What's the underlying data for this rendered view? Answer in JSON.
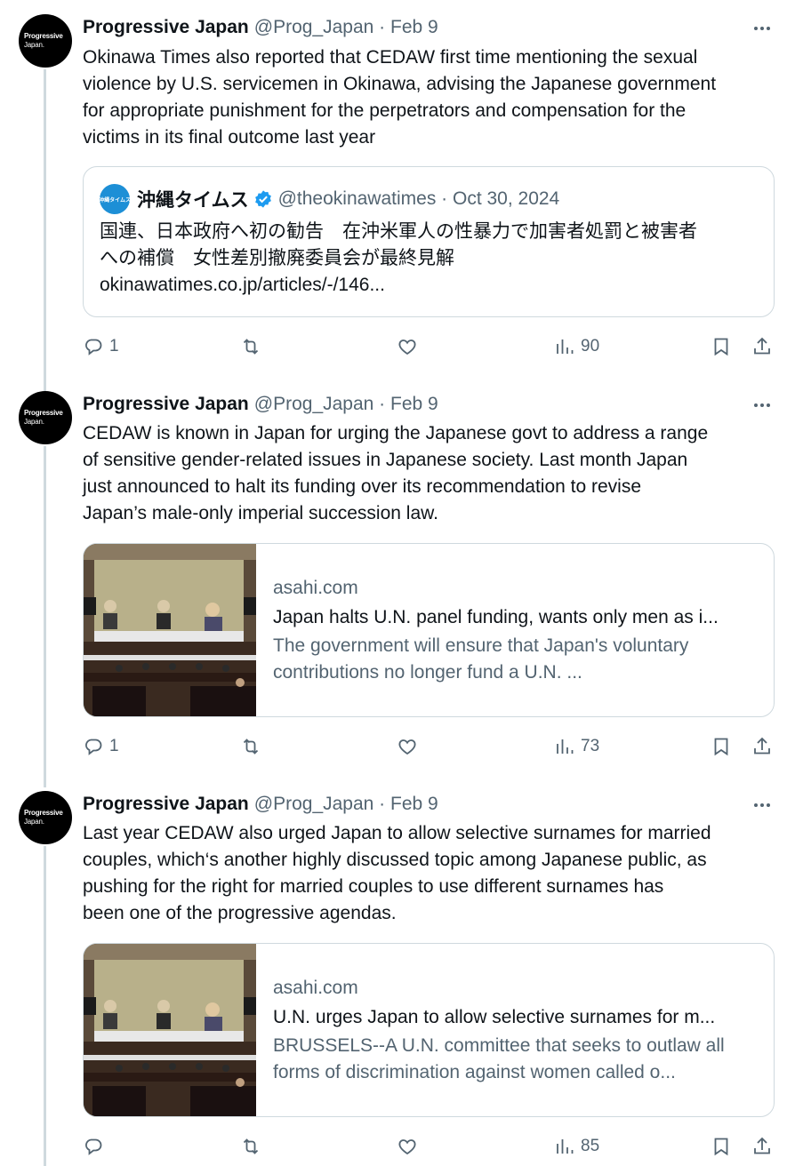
{
  "tweets": [
    {
      "author_name": "Progressive Japan",
      "handle_time": "@Prog_Japan · Feb 9",
      "avatar": {
        "line1": "Progressive",
        "line2": "Japan."
      },
      "text": "Okinawa Times also reported that CEDAW first time mentioning the sexual\nviolence by U.S. servicemen in Okinawa, advising the Japanese government\nfor appropriate punishment for the perpetrators and compensation for the\nvictims in its final outcome last year",
      "quote": {
        "avatar_text": "沖縄タイムス",
        "author_name": "沖縄タイムス",
        "handle_time": "@theokinawatimes · Oct 30, 2024",
        "text": "国連、日本政府へ初の勧告　在沖米軍人の性暴力で加害者処罰と被害者\nへの補償　女性差別撤廃委員会が最終見解\nokinawatimes.co.jp/articles/-/146..."
      },
      "replies": "1",
      "retweets": "",
      "likes": "",
      "views": "90"
    },
    {
      "author_name": "Progressive Japan",
      "handle_time": "@Prog_Japan · Feb 9",
      "avatar": {
        "line1": "Progressive",
        "line2": "Japan."
      },
      "text": "CEDAW is known in Japan for urging the Japanese govt to address a range\nof sensitive gender-related issues in Japanese society. Last month Japan\njust announced to halt its funding over its recommendation to revise\nJapan’s male-only imperial succession law.",
      "card": {
        "domain": "asahi.com",
        "title": "Japan halts U.N. panel funding, wants only men as i...",
        "description": "The government will ensure that Japan's voluntary contributions no longer fund a U.N. ..."
      },
      "replies": "1",
      "retweets": "",
      "likes": "",
      "views": "73"
    },
    {
      "author_name": "Progressive Japan",
      "handle_time": "@Prog_Japan · Feb 9",
      "avatar": {
        "line1": "Progressive",
        "line2": "Japan."
      },
      "text": "Last year CEDAW also urged Japan to allow selective surnames for married\ncouples, which‘s another highly discussed topic among Japanese public, as\npushing for the right for married couples to use different surnames has\nbeen one of the progressive agendas.",
      "card": {
        "domain": "asahi.com",
        "title": "U.N. urges Japan to allow selective surnames for m...",
        "description": "BRUSSELS--A U.N. committee that seeks to outlaw all forms of discrimination against women called o..."
      },
      "replies": "",
      "retweets": "",
      "likes": "",
      "views": "85"
    }
  ],
  "icons": {
    "reply": "reply-icon",
    "retweet": "retweet-icon",
    "like": "like-icon",
    "views": "views-icon",
    "bookmark": "bookmark-icon",
    "share": "share-icon",
    "more": "more-icon",
    "verified": "verified-icon"
  },
  "colors": {
    "text": "#0f1419",
    "secondary": "#536471",
    "border": "#cfd9de",
    "verified": "#1d9bf0"
  }
}
